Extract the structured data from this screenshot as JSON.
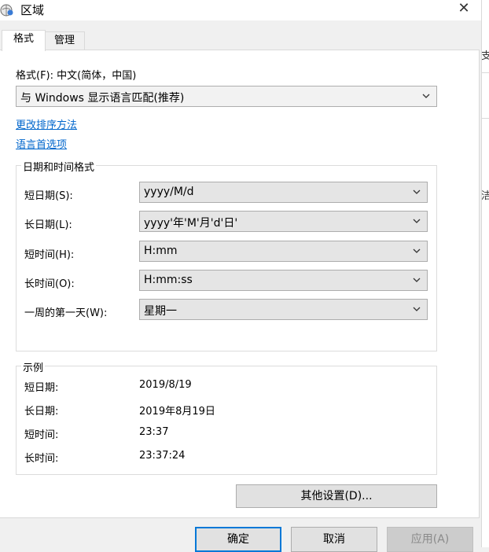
{
  "window": {
    "title": "区域",
    "close_glyph": "✕"
  },
  "right_strip": {
    "glyph_top": "支",
    "glyph_bottom": "洁"
  },
  "tabs": [
    {
      "label": "格式",
      "active": true
    },
    {
      "label": "管理",
      "active": false
    }
  ],
  "format": {
    "label": "格式(F): 中文(简体，中国)",
    "selected": "与 Windows 显示语言匹配(推荐)"
  },
  "links": {
    "change_sort": "更改排序方法",
    "language_prefs": "语言首选项"
  },
  "datetime": {
    "group_title": "日期和时间格式",
    "rows": [
      {
        "label": "短日期(S):",
        "value": "yyyy/M/d"
      },
      {
        "label": "长日期(L):",
        "value": "yyyy'年'M'月'd'日'"
      },
      {
        "label": "短时间(H):",
        "value": "H:mm"
      },
      {
        "label": "长时间(O):",
        "value": "H:mm:ss"
      },
      {
        "label": "一周的第一天(W):",
        "value": "星期一"
      }
    ]
  },
  "examples": {
    "group_title": "示例",
    "rows": [
      {
        "label": "短日期:",
        "value": "2019/8/19"
      },
      {
        "label": "长日期:",
        "value": "2019年8月19日"
      },
      {
        "label": "短时间:",
        "value": "23:37"
      },
      {
        "label": "长时间:",
        "value": "23:37:24"
      }
    ]
  },
  "buttons": {
    "additional": "其他设置(D)...",
    "ok": "确定",
    "cancel": "取消",
    "apply": "应用(A)"
  },
  "icons": {
    "title_icon": "globe-clock-icon",
    "combo_arrow": "chevron-down-icon"
  },
  "colors": {
    "link": "#0066cc",
    "default_button_border": "#0078d7"
  }
}
